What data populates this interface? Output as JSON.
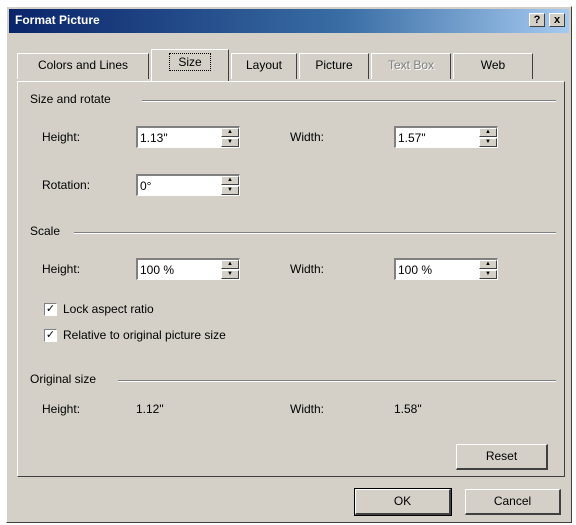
{
  "window": {
    "title": "Format Picture",
    "help_label": "?",
    "close_label": "x"
  },
  "tabs": [
    {
      "label": "Colors and Lines"
    },
    {
      "label": "Size"
    },
    {
      "label": "Layout"
    },
    {
      "label": "Picture"
    },
    {
      "label": "Text Box"
    },
    {
      "label": "Web"
    }
  ],
  "size_rotate": {
    "label": "Size and rotate",
    "height_label": "Height:",
    "height_value": "1.13\"",
    "width_label": "Width:",
    "width_value": "1.57\"",
    "rotation_label": "Rotation:",
    "rotation_value": "0°"
  },
  "scale": {
    "label": "Scale",
    "height_label": "Height:",
    "height_value": "100 %",
    "width_label": "Width:",
    "width_value": "100 %",
    "lock_aspect_label": "Lock aspect ratio",
    "lock_aspect_checked": true,
    "relative_label": "Relative to original picture size",
    "relative_checked": true
  },
  "original_size": {
    "label": "Original size",
    "height_label": "Height:",
    "height_value": "1.12\"",
    "width_label": "Width:",
    "width_value": "1.58\""
  },
  "buttons": {
    "reset": "Reset",
    "ok": "OK",
    "cancel": "Cancel"
  }
}
